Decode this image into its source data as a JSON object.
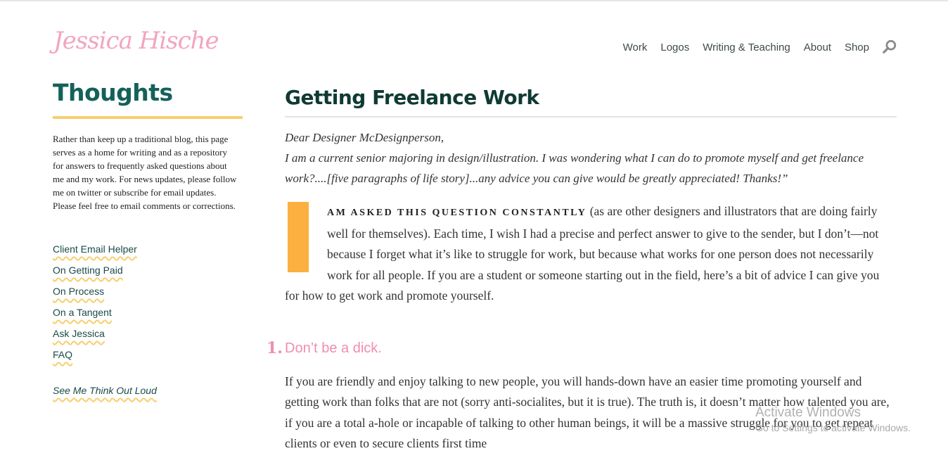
{
  "header": {
    "logo_text": "Jessica Hische",
    "nav": [
      "Work",
      "Logos",
      "Writing & Teaching",
      "About",
      "Shop"
    ],
    "search_icon": "magnifier-icon"
  },
  "sidebar": {
    "title": "Thoughts",
    "intro": "Rather than keep up a traditional blog, this page serves as a home for writing and as a repository for answers to frequently asked questions about me and my work. For news updates, please follow me on twitter or subscribe for email updates. Please feel free to email comments or corrections.",
    "links": [
      "Client Email Helper",
      "On Getting Paid",
      "On Process",
      "On a Tangent",
      "Ask Jessica",
      "FAQ"
    ],
    "think_link": "See Me Think Out Loud"
  },
  "article": {
    "title": "Getting Freelance Work",
    "letter_greeting": "Dear Designer McDesignperson,",
    "letter_body": "I am a current senior majoring in design/illustration. I was wondering what I can do to promote myself and get freelance work?....[five paragraphs of life story]...any advice you can give would be greatly appreciated! Thanks!”",
    "dropcap": "I",
    "lead_smallcaps": "am asked this question constantly",
    "lead_rest": " (as are other designers and illustrators that are doing fairly well for themselves). Each time, I wish I had a precise and perfect answer to give to the sender, but I don’t—not because I forget what it’s like to struggle for work, but because what works for one person does not necessarily work for all people. If you are a student or someone starting out in the field, here’s a bit of advice I can give you for how to get work and promote yourself.",
    "section_number": "1.",
    "section_heading": "Don’t be a dick.",
    "section_body": "If you are friendly and enjoy talking to new people, you will hands-down have an easier time promoting yourself and getting work than folks that are not (sorry anti-socialites, but it is true). The truth is, it doesn’t matter how talented you are, if you are a total a-hole or incapable of talking to other human beings, it will be a massive struggle for you to get repeat clients or even to secure clients first time"
  },
  "watermark": {
    "line1": "Activate Windows",
    "line2": "Go to Settings to activate Windows."
  },
  "colors": {
    "accent_pink": "#f2a5c0",
    "title_green": "#14615a",
    "underline_yellow": "#f7cf6e",
    "dropcap_orange": "#fbb040"
  }
}
